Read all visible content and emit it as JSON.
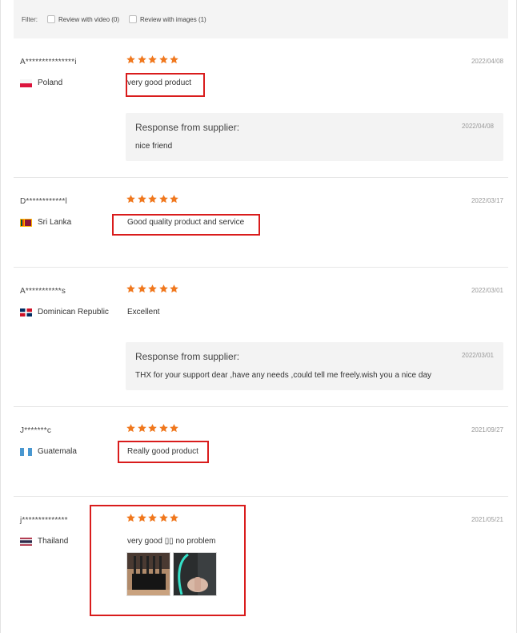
{
  "filter": {
    "label": "Filter:",
    "options": [
      {
        "label": "Review with video (0)",
        "checked": false
      },
      {
        "label": "Review with images (1)",
        "checked": false
      }
    ]
  },
  "reviews": [
    {
      "name": "A***************i",
      "country": "Poland",
      "flag_icon": "poland-flag-icon",
      "rating": 5,
      "date": "2022/04/08",
      "text": "very good product",
      "response": {
        "title": "Response from supplier:",
        "date": "2022/04/08",
        "text": "nice friend"
      }
    },
    {
      "name": "D************l",
      "country": "Sri Lanka",
      "flag_icon": "sri-lanka-flag-icon",
      "rating": 5,
      "date": "2022/03/17",
      "text": "Good quality product and service"
    },
    {
      "name": "A***********s",
      "country": "Dominican Republic",
      "flag_icon": "dominican-republic-flag-icon",
      "rating": 5,
      "date": "2022/03/01",
      "text": "Excellent",
      "response": {
        "title": "Response from supplier:",
        "date": "2022/03/01",
        "text": "THX for your support dear ,have any needs ,could tell me freely.wish you a nice day"
      }
    },
    {
      "name": "J*******c",
      "country": "Guatemala",
      "flag_icon": "guatemala-flag-icon",
      "rating": 5,
      "date": "2021/09/27",
      "text": "Really good product"
    },
    {
      "name": "j**************",
      "country": "Thailand",
      "flag_icon": "thailand-flag-icon",
      "rating": 5,
      "date": "2021/05/21",
      "text": "very good ▯▯ no problem",
      "photos": [
        "review-photo-1",
        "review-photo-2"
      ]
    }
  ],
  "colors": {
    "star": "#f0781e",
    "highlight": "#d91c1c",
    "panel": "#f3f3f3"
  }
}
